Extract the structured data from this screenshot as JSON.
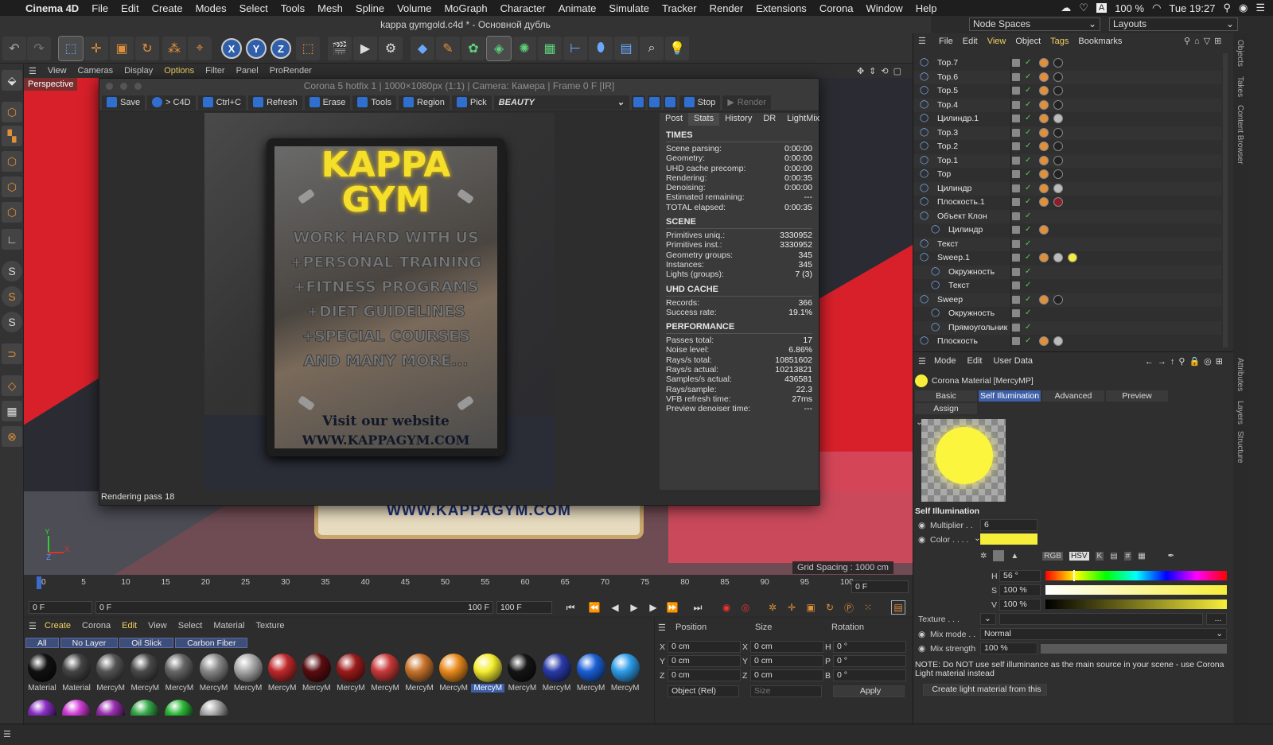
{
  "mac": {
    "apple": "",
    "app": "Cinema 4D",
    "menus": [
      "File",
      "Edit",
      "Create",
      "Modes",
      "Select",
      "Tools",
      "Mesh",
      "Spline",
      "Volume",
      "MoGraph",
      "Character",
      "Animate",
      "Simulate",
      "Tracker",
      "Render",
      "Extensions",
      "Corona",
      "Window",
      "Help"
    ],
    "battery": "100 %",
    "time": "Tue 19:27"
  },
  "window": {
    "title": "kappa gymgold.c4d * - Основной дубль",
    "node_spaces": "Node Spaces",
    "layouts": "Layouts"
  },
  "viewport": {
    "menus": [
      "View",
      "Cameras",
      "Display",
      "Options",
      "Filter",
      "Panel",
      "ProRender"
    ],
    "label": "Perspective",
    "grid": "Grid Spacing : 1000 cm",
    "sign_text": "WWW.KAPPAGYM.COM",
    "axis_x": "X",
    "axis_y": "Y",
    "axis_z": "Z"
  },
  "vfb": {
    "title": "Corona 5 hotfix 1 | 1000×1080px (1:1) | Camera: Камера | Frame 0 F [IR]",
    "buttons": {
      "save": "Save",
      "c4d": "> C4D",
      "copy": "Ctrl+C",
      "refresh": "Refresh",
      "erase": "Erase",
      "tools": "Tools",
      "region": "Region",
      "pick": "Pick",
      "pass": "BEAUTY",
      "stop": "Stop",
      "render": "Render"
    },
    "status": "Rendering pass 18",
    "poster": {
      "title1": "KAPPA",
      "title2": "GYM",
      "lines": [
        "WORK HARD WITH US",
        "+PERSONAL TRAINING",
        "+FITNESS PROGRAMS",
        "+DIET GUIDELINES",
        "+SPECIAL COURSES",
        "AND MANY MORE..."
      ],
      "visit": "Visit our website",
      "url": "www.kappagym.com"
    },
    "tabs": [
      "Post",
      "Stats",
      "History",
      "DR",
      "LightMix"
    ],
    "sections": [
      {
        "title": "TIMES",
        "rows": [
          [
            "Scene parsing:",
            "0:00:00"
          ],
          [
            "Geometry:",
            "0:00:00"
          ],
          [
            "UHD cache precomp:",
            "0:00:00"
          ],
          [
            "Rendering:",
            "0:00:35"
          ],
          [
            "Denoising:",
            "0:00:00"
          ],
          [
            "Estimated remaining:",
            "---"
          ],
          [
            "TOTAL elapsed:",
            "0:00:35"
          ]
        ]
      },
      {
        "title": "SCENE",
        "rows": [
          [
            "Primitives uniq.:",
            "3330952"
          ],
          [
            "Primitives inst.:",
            "3330952"
          ],
          [
            "Geometry groups:",
            "345"
          ],
          [
            "Instances:",
            "345"
          ],
          [
            "Lights (groups):",
            "7 (3)"
          ]
        ]
      },
      {
        "title": "UHD CACHE",
        "rows": [
          [
            "Records:",
            "366"
          ],
          [
            "Success rate:",
            "19.1%"
          ]
        ]
      },
      {
        "title": "PERFORMANCE",
        "rows": [
          [
            "Passes total:",
            "17"
          ],
          [
            "Noise level:",
            "6.86%"
          ],
          [
            "Rays/s total:",
            "10851602"
          ],
          [
            "Rays/s actual:",
            "10213821"
          ],
          [
            "Samples/s actual:",
            "436581"
          ],
          [
            "Rays/sample:",
            "22.3"
          ],
          [
            "VFB refresh time:",
            "27ms"
          ],
          [
            "Preview denoiser time:",
            "---"
          ]
        ]
      }
    ]
  },
  "timeline": {
    "ticks": [
      "0",
      "5",
      "10",
      "15",
      "20",
      "25",
      "30",
      "35",
      "40",
      "45",
      "50",
      "55",
      "60",
      "65",
      "70",
      "75",
      "80",
      "85",
      "90",
      "95",
      "100"
    ],
    "current": "0 F",
    "start": "0 F",
    "start2": "0 F",
    "end": "100 F",
    "end2": "100 F",
    "right_field": "0 F"
  },
  "materials": {
    "menus": [
      "Create",
      "Corona",
      "Edit",
      "View",
      "Select",
      "Material",
      "Texture"
    ],
    "tabs": [
      "All",
      "No Layer",
      "Oil Slick",
      "Carbon Fiber"
    ],
    "items": [
      {
        "name": "Material",
        "color": "#111"
      },
      {
        "name": "Material",
        "color": "#444"
      },
      {
        "name": "MercyM",
        "color": "#555"
      },
      {
        "name": "MercyM",
        "color": "#4a4a4a"
      },
      {
        "name": "MercyM",
        "color": "#666"
      },
      {
        "name": "MercyM",
        "color": "#888"
      },
      {
        "name": "MercyM",
        "color": "#aaa"
      },
      {
        "name": "MercyM",
        "color": "#c0282b"
      },
      {
        "name": "MercyM",
        "color": "#5a0d10"
      },
      {
        "name": "MercyM",
        "color": "#9c1b1b"
      },
      {
        "name": "MercyM",
        "color": "#c83a3a"
      },
      {
        "name": "MercyM",
        "color": "#c8742c"
      },
      {
        "name": "MercyM",
        "color": "#e98a1d"
      },
      {
        "name": "MercyM",
        "color": "#f5ee30"
      },
      {
        "name": "MercyM",
        "color": "#151515"
      },
      {
        "name": "MercyM",
        "color": "#2a3aa8"
      },
      {
        "name": "MercyM",
        "color": "#1b5fd6"
      },
      {
        "name": "MercyM",
        "color": "#2e9ce8"
      }
    ],
    "row2": [
      "#8a2fc4",
      "#d03fd6",
      "#9a2fb0",
      "#36a84a",
      "#2fba3a",
      "#aaaaaa"
    ]
  },
  "coords": {
    "headers": [
      "Position",
      "Size",
      "Rotation"
    ],
    "axes": [
      "X",
      "Y",
      "Z"
    ],
    "raxes": [
      "H",
      "P",
      "B"
    ],
    "pos": [
      "0 cm",
      "0 cm",
      "0 cm"
    ],
    "size": [
      "0 cm",
      "0 cm",
      "0 cm"
    ],
    "rot": [
      "0 °",
      "0 °",
      "0 °"
    ],
    "mode": "Object (Rel)",
    "size_mode": "Size",
    "apply": "Apply"
  },
  "objects": {
    "menus": [
      "File",
      "Edit",
      "View",
      "Object",
      "Tags",
      "Bookmarks"
    ],
    "rows": [
      {
        "name": "Тор.7",
        "indent": 0,
        "tags": [
          "orange",
          "ball"
        ]
      },
      {
        "name": "Тор.6",
        "indent": 0,
        "tags": [
          "orange",
          "ball"
        ]
      },
      {
        "name": "Тор.5",
        "indent": 0,
        "tags": [
          "orange",
          "ball"
        ]
      },
      {
        "name": "Тор.4",
        "indent": 0,
        "tags": [
          "orange",
          "ball"
        ]
      },
      {
        "name": "Цилиндр.1",
        "indent": 0,
        "tags": [
          "orange",
          "gray"
        ]
      },
      {
        "name": "Тор.3",
        "indent": 0,
        "tags": [
          "orange",
          "ball"
        ]
      },
      {
        "name": "Тор.2",
        "indent": 0,
        "tags": [
          "orange",
          "ball"
        ]
      },
      {
        "name": "Тор.1",
        "indent": 0,
        "tags": [
          "orange",
          "ball"
        ]
      },
      {
        "name": "Тор",
        "indent": 0,
        "tags": [
          "orange",
          "ball"
        ]
      },
      {
        "name": "Цилиндр",
        "indent": 0,
        "tags": [
          "orange",
          "gray"
        ]
      },
      {
        "name": "Плоскость.1",
        "indent": 0,
        "tags": [
          "orange",
          "red"
        ]
      },
      {
        "name": "Объект Клон",
        "indent": 0,
        "tags": []
      },
      {
        "name": "Цилиндр",
        "indent": 1,
        "tags": [
          "orange"
        ]
      },
      {
        "name": "Текст",
        "indent": 0,
        "tags": []
      },
      {
        "name": "Sweep.1",
        "indent": 0,
        "tags": [
          "orange",
          "gray",
          "yellow"
        ]
      },
      {
        "name": "Окружность",
        "indent": 1,
        "tags": []
      },
      {
        "name": "Текст",
        "indent": 1,
        "tags": []
      },
      {
        "name": "Sweep",
        "indent": 0,
        "tags": [
          "orange",
          "ball"
        ]
      },
      {
        "name": "Окружность",
        "indent": 1,
        "tags": []
      },
      {
        "name": "Прямоугольник",
        "indent": 1,
        "tags": []
      },
      {
        "name": "Плоскость",
        "indent": 0,
        "tags": [
          "orange",
          "gray"
        ]
      }
    ]
  },
  "attributes": {
    "menus": [
      "Mode",
      "Edit",
      "User Data"
    ],
    "material": "Corona Material [MercyMP]",
    "tabs": [
      "Basic",
      "Self Illumination",
      "Advanced",
      "Preview"
    ],
    "assign": "Assign",
    "section": "Self Illumination",
    "multiplier_label": "Multiplier . .",
    "multiplier": "6",
    "color_label": "Color . . . .",
    "color": "#f6ee3a",
    "h_label": "H",
    "h": "56 °",
    "s_label": "S",
    "s": "100 %",
    "v_label": "V",
    "v": "100 %",
    "rgb": "RGB",
    "hsv": "HSV",
    "k": "K",
    "hash": "#",
    "texture_label": "Texture . . .",
    "texture_btn": "...",
    "mix_mode_label": "Mix mode . .",
    "mix_mode": "Normal",
    "mix_strength_label": "Mix strength",
    "mix_strength": "100 %",
    "note": "NOTE: Do NOT use self illuminance as the main source in your scene - use Corona Light material instead",
    "create_btn": "Create light material from this"
  },
  "side_tabs": [
    "Objects",
    "Takes",
    "Content Browser",
    "Attributes",
    "Layers",
    "Structure"
  ]
}
